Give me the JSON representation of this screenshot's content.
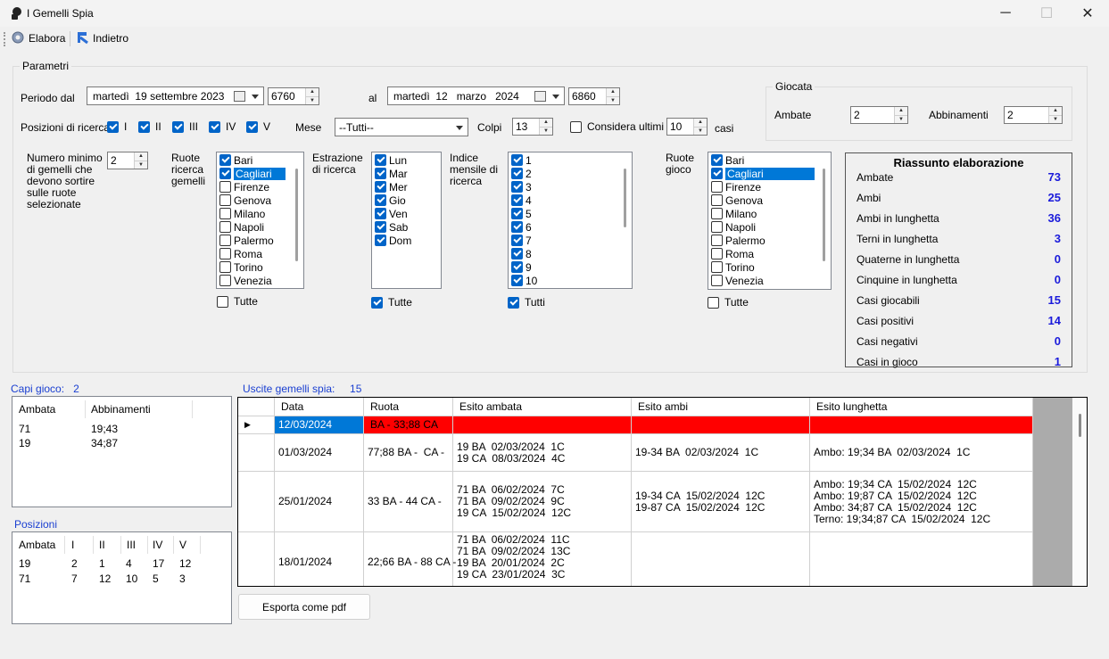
{
  "window": {
    "title": "I Gemelli Spia"
  },
  "toolbar": {
    "elabora": "Elabora",
    "indietro": "Indietro"
  },
  "parametri": {
    "title": "Parametri",
    "periodo_label": "Periodo dal",
    "al_label": "al",
    "date_from": {
      "weekday": "martedì",
      "day": "19",
      "month": "settembre",
      "year": "2023",
      "num": "6760"
    },
    "date_to": {
      "weekday": "martedì",
      "day": "12",
      "month": "marzo",
      "year": "2024",
      "num": "6860"
    },
    "posizioni_label": "Posizioni di ricerca",
    "posizioni": [
      {
        "label": "I",
        "checked": true
      },
      {
        "label": "II",
        "checked": true
      },
      {
        "label": "III",
        "checked": true
      },
      {
        "label": "IV",
        "checked": true
      },
      {
        "label": "V",
        "checked": true
      }
    ],
    "mese_label": "Mese",
    "mese_value": "--Tutti--",
    "colpi_label": "Colpi",
    "colpi_value": "13",
    "considera_label": "Considera ultimi",
    "considera_value": "10",
    "casi_label": "casi",
    "numero_minimo_label": "Numero minimo di gemelli che devono sortire sulle ruote selezionate",
    "numero_minimo_value": "2",
    "ruote_ricerca_label": "Ruote ricerca gemelli",
    "ruote_ricerca": [
      {
        "label": "Bari",
        "checked": true,
        "selected": false
      },
      {
        "label": "Cagliari",
        "checked": true,
        "selected": true
      },
      {
        "label": "Firenze",
        "checked": false,
        "selected": false
      },
      {
        "label": "Genova",
        "checked": false,
        "selected": false
      },
      {
        "label": "Milano",
        "checked": false,
        "selected": false
      },
      {
        "label": "Napoli",
        "checked": false,
        "selected": false
      },
      {
        "label": "Palermo",
        "checked": false,
        "selected": false
      },
      {
        "label": "Roma",
        "checked": false,
        "selected": false
      },
      {
        "label": "Torino",
        "checked": false,
        "selected": false
      },
      {
        "label": "Venezia",
        "checked": false,
        "selected": false
      }
    ],
    "ruote_ricerca_tutte": {
      "label": "Tutte",
      "checked": false
    },
    "estrazione_label": "Estrazione di ricerca",
    "estrazione": [
      {
        "label": "Lun",
        "checked": true
      },
      {
        "label": "Mar",
        "checked": true
      },
      {
        "label": "Mer",
        "checked": true
      },
      {
        "label": "Gio",
        "checked": true
      },
      {
        "label": "Ven",
        "checked": true
      },
      {
        "label": "Sab",
        "checked": true
      },
      {
        "label": "Dom",
        "checked": true
      }
    ],
    "estrazione_tutte": {
      "label": "Tutte",
      "checked": true
    },
    "indice_label": "Indice mensile di ricerca",
    "indice": [
      {
        "label": "1",
        "checked": true
      },
      {
        "label": "2",
        "checked": true
      },
      {
        "label": "3",
        "checked": true
      },
      {
        "label": "4",
        "checked": true
      },
      {
        "label": "5",
        "checked": true
      },
      {
        "label": "6",
        "checked": true
      },
      {
        "label": "7",
        "checked": true
      },
      {
        "label": "8",
        "checked": true
      },
      {
        "label": "9",
        "checked": true
      },
      {
        "label": "10",
        "checked": true
      }
    ],
    "indice_tutti": {
      "label": "Tutti",
      "checked": true
    },
    "ruote_gioco_label": "Ruote gioco",
    "ruote_gioco": [
      {
        "label": "Bari",
        "checked": true,
        "selected": false
      },
      {
        "label": "Cagliari",
        "checked": true,
        "selected": true
      },
      {
        "label": "Firenze",
        "checked": false,
        "selected": false
      },
      {
        "label": "Genova",
        "checked": false,
        "selected": false
      },
      {
        "label": "Milano",
        "checked": false,
        "selected": false
      },
      {
        "label": "Napoli",
        "checked": false,
        "selected": false
      },
      {
        "label": "Palermo",
        "checked": false,
        "selected": false
      },
      {
        "label": "Roma",
        "checked": false,
        "selected": false
      },
      {
        "label": "Torino",
        "checked": false,
        "selected": false
      },
      {
        "label": "Venezia",
        "checked": false,
        "selected": false
      }
    ],
    "ruote_gioco_tutte": {
      "label": "Tutte",
      "checked": false
    }
  },
  "giocata": {
    "title": "Giocata",
    "ambate_label": "Ambate",
    "ambate_value": "2",
    "abbinamenti_label": "Abbinamenti",
    "abbinamenti_value": "2"
  },
  "riassunto": {
    "title": "Riassunto elaborazione",
    "rows": [
      {
        "label": "Ambate",
        "value": "73"
      },
      {
        "label": "Ambi",
        "value": "25"
      },
      {
        "label": "Ambi in lunghetta",
        "value": "36"
      },
      {
        "label": "Terni in lunghetta",
        "value": "3"
      },
      {
        "label": "Quaterne in lunghetta",
        "value": "0"
      },
      {
        "label": "Cinquine in lunghetta",
        "value": "0"
      },
      {
        "label": "Casi giocabili",
        "value": "15"
      },
      {
        "label": "Casi positivi",
        "value": "14"
      },
      {
        "label": "Casi negativi",
        "value": "0"
      },
      {
        "label": "Casi in gioco",
        "value": "1"
      }
    ]
  },
  "capi": {
    "label": "Capi gioco:",
    "count": "2",
    "headers": [
      "Ambata",
      "Abbinamenti"
    ],
    "rows": [
      [
        "71",
        "19;43"
      ],
      [
        "19",
        "34;87"
      ]
    ]
  },
  "posizioni_tbl": {
    "label": "Posizioni",
    "headers": [
      "Ambata",
      "I",
      "II",
      "III",
      "IV",
      "V"
    ],
    "rows": [
      [
        "19",
        "2",
        "1",
        "4",
        "17",
        "12"
      ],
      [
        "71",
        "7",
        "12",
        "10",
        "5",
        "3"
      ]
    ]
  },
  "uscite": {
    "label": "Uscite gemelli spia:",
    "count": "15",
    "headers": [
      "Data",
      "Ruota",
      "Esito ambata",
      "Esito ambi",
      "Esito lunghetta"
    ],
    "rows": [
      {
        "data": "12/03/2024",
        "ruota": "BA - 33;88 CA",
        "ambata": "",
        "ambi": "",
        "lunghetta": ""
      },
      {
        "data": "01/03/2024",
        "ruota": "77;88 BA -  CA -",
        "ambata": "19 BA  02/03/2024  1C\n19 CA  08/03/2024  4C",
        "ambi": "19-34 BA  02/03/2024  1C",
        "lunghetta": "Ambo: 19;34 BA  02/03/2024  1C"
      },
      {
        "data": "25/01/2024",
        "ruota": "33 BA - 44 CA -",
        "ambata": "71 BA  06/02/2024  7C\n71 BA  09/02/2024  9C\n19 CA  15/02/2024  12C",
        "ambi": "19-34 CA  15/02/2024  12C\n19-87 CA  15/02/2024  12C",
        "lunghetta": "Ambo: 19;34 CA  15/02/2024  12C\nAmbo: 19;87 CA  15/02/2024  12C\nAmbo: 34;87 CA  15/02/2024  12C\nTerno: 19;34;87 CA  15/02/2024  12C"
      },
      {
        "data": "18/01/2024",
        "ruota": "22;66 BA - 88 CA -",
        "ambata": "71 BA  06/02/2024  11C\n71 BA  09/02/2024  13C\n19 BA  20/01/2024  2C\n19 CA  23/01/2024  3C",
        "ambi": "",
        "lunghetta": ""
      }
    ]
  },
  "export_button": "Esporta come pdf",
  "colors": {
    "accent": "#0064c8",
    "highlight_row": "#ff0000",
    "selected_cell": "#0078d7",
    "summary_value": "#1a1adb",
    "section_label": "#1a3fd1"
  },
  "icons": {
    "app": "app-icon",
    "elabora": "gear-icon",
    "indietro": "back-arrow-icon"
  }
}
